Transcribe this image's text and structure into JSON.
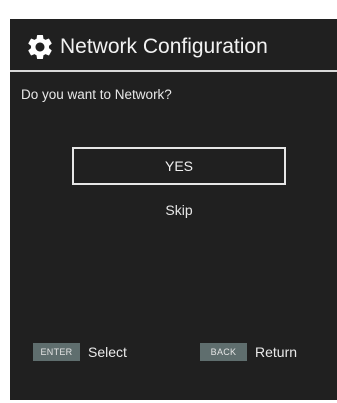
{
  "header": {
    "title": "Network Configuration",
    "icon": "gear-icon"
  },
  "prompt": {
    "question": "Do you want to Network?"
  },
  "options": {
    "yes_label": "YES",
    "skip_label": "Skip"
  },
  "footer": {
    "enter_key": "ENTER",
    "enter_label": "Select",
    "back_key": "BACK",
    "back_label": "Return"
  },
  "colors": {
    "background": "#202020",
    "text": "#ffffff",
    "key_badge": "#5f6e6e"
  }
}
